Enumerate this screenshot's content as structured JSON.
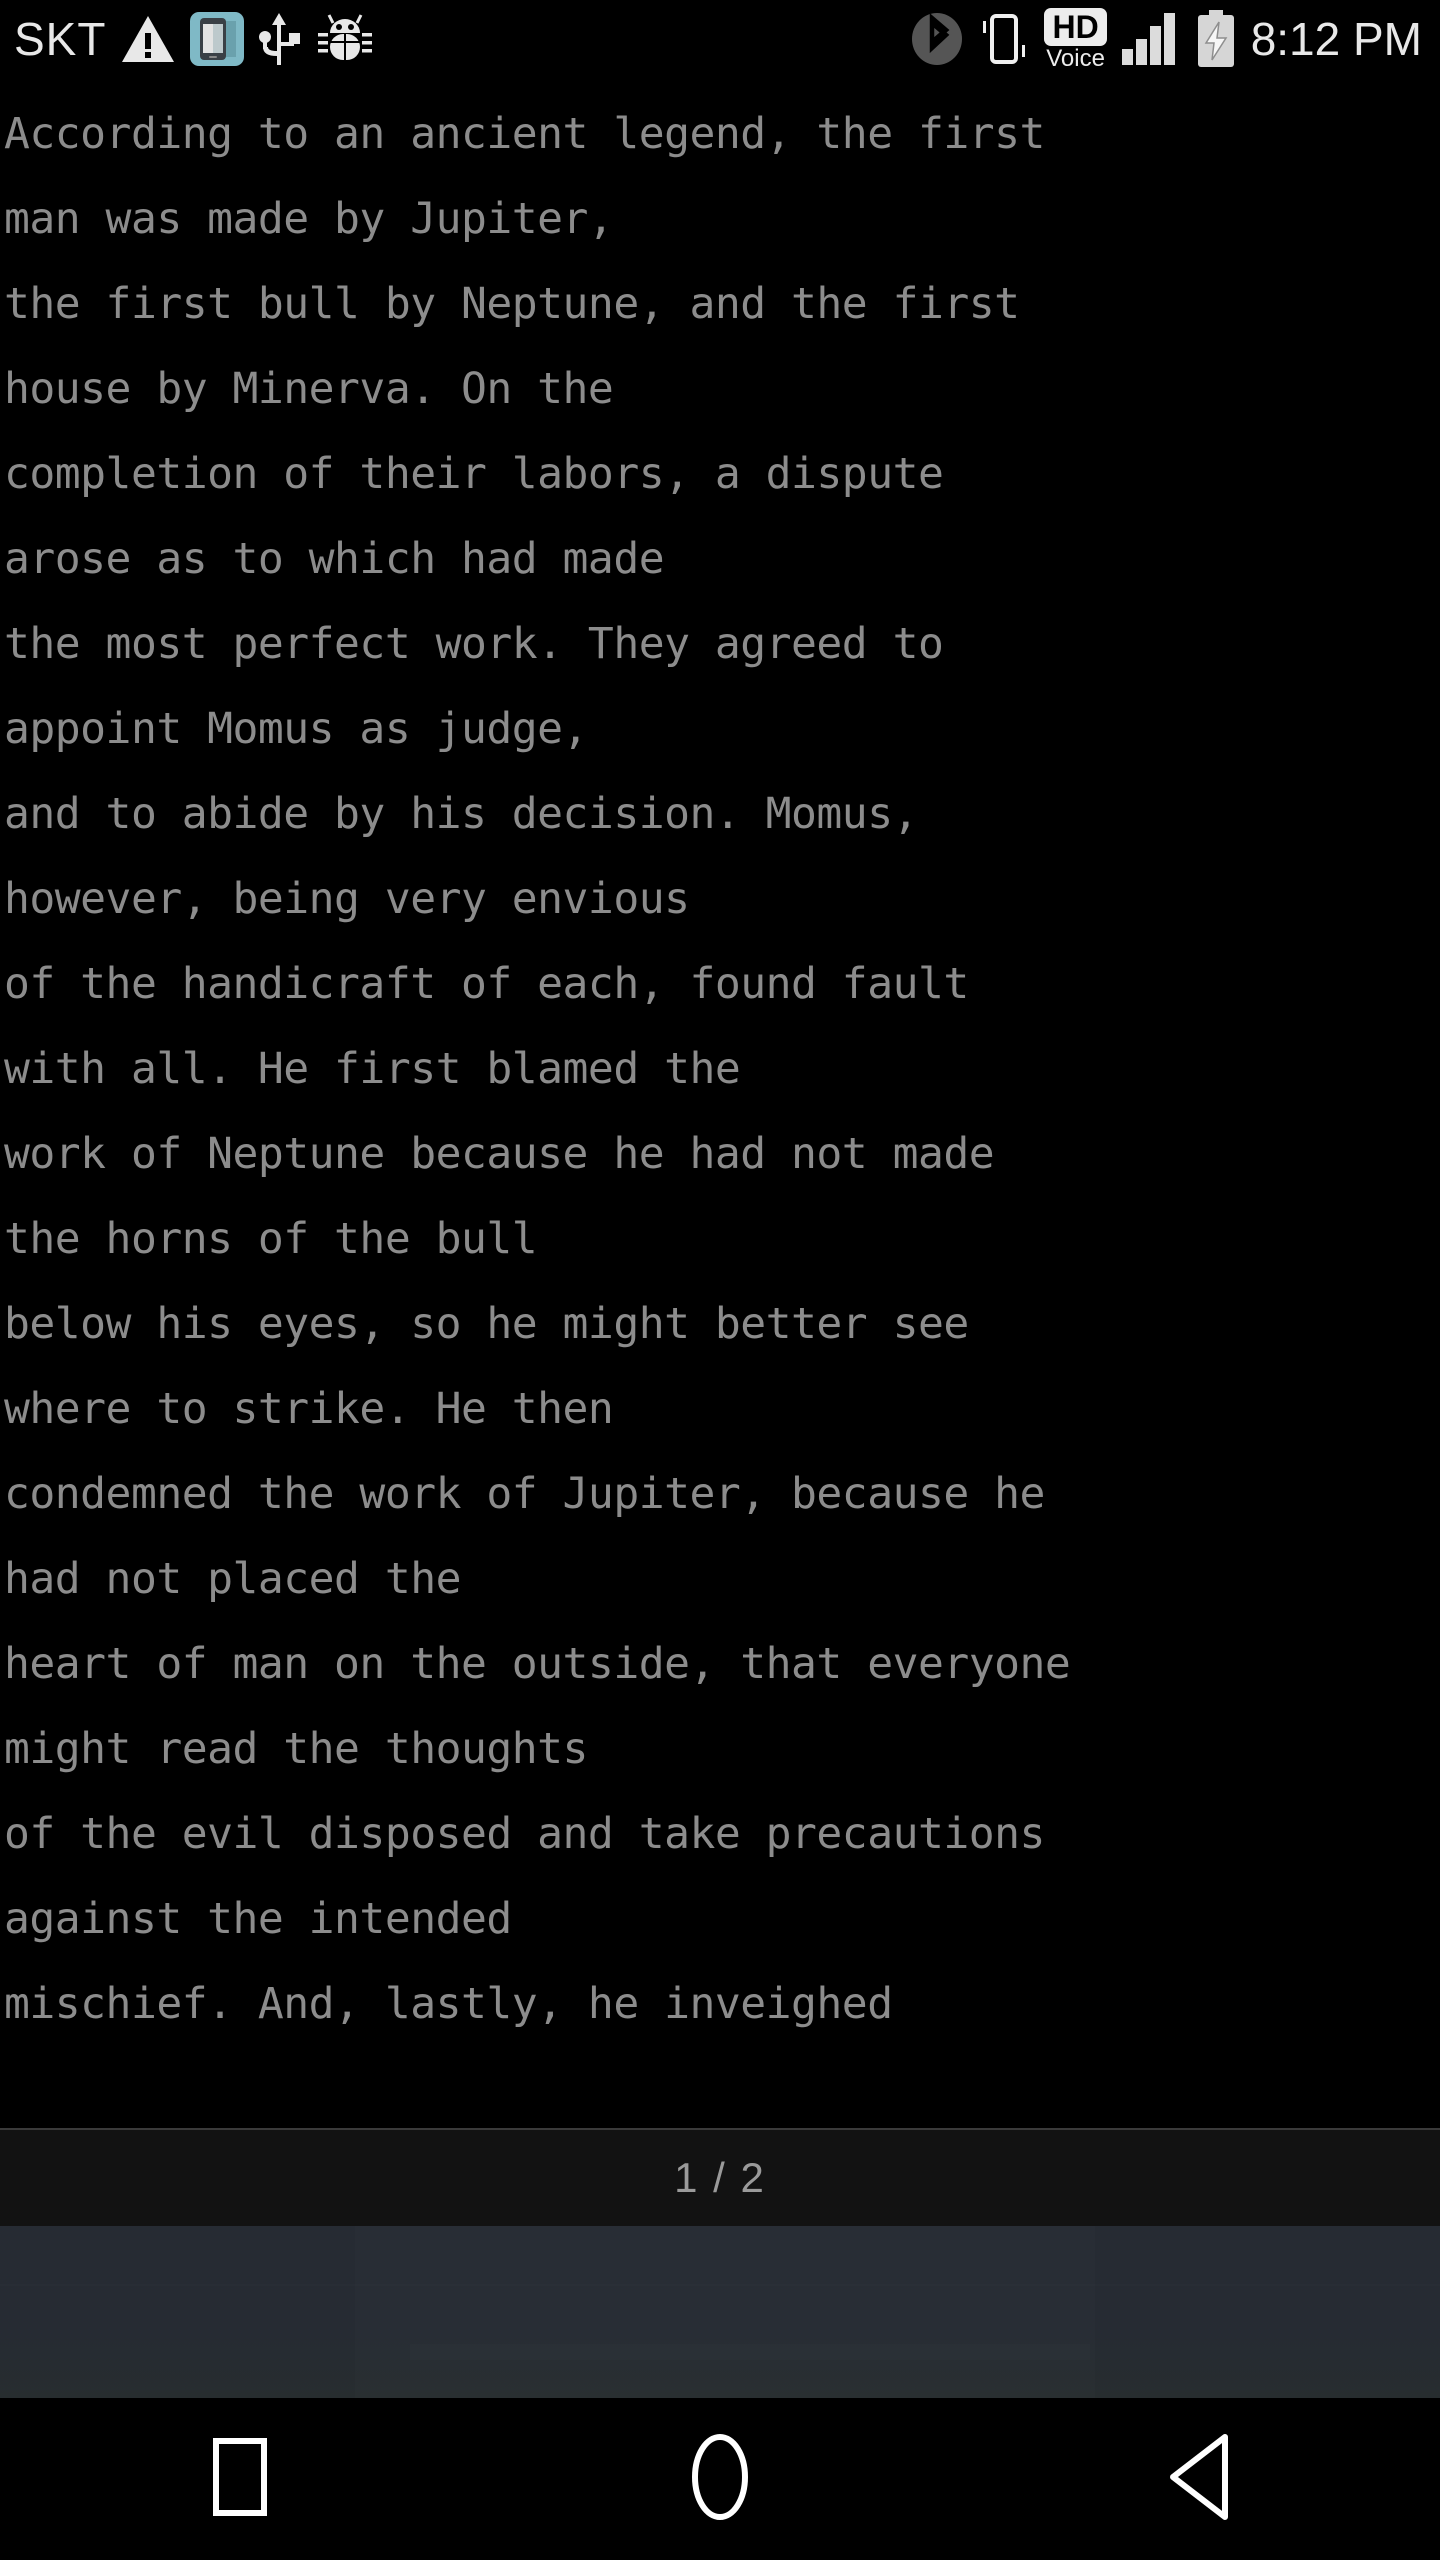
{
  "status_bar": {
    "carrier": "SKT",
    "clock": "8:12 PM",
    "hd_voice_label": "HD",
    "hd_voice_sub": "Voice",
    "left_icons": [
      {
        "name": "warning-triangle-icon",
        "label": "warning"
      },
      {
        "name": "phone-app-icon",
        "label": "device app"
      },
      {
        "name": "usb-icon",
        "label": "usb connected"
      },
      {
        "name": "android-debug-bug-icon",
        "label": "usb debugging"
      }
    ],
    "right_icons": [
      {
        "name": "bluetooth-icon",
        "label": "bluetooth"
      },
      {
        "name": "vibrate-icon",
        "label": "vibrate mode"
      },
      {
        "name": "hd-voice-icon",
        "label": "HD Voice"
      },
      {
        "name": "signal-bars-icon",
        "label": "signal strength"
      },
      {
        "name": "battery-charging-icon",
        "label": "battery charging"
      }
    ],
    "colors": {
      "background": "#000000",
      "icon_light": "#e8e8e8",
      "icon_dim": "#5a5a5a",
      "phone_app_accent": "#7fb9c6"
    }
  },
  "reader": {
    "text_color": "#8c8c8c",
    "background": "#000000",
    "lines": [
      "According to an ancient legend, the first",
      "man was made by Jupiter,",
      "the first bull by Neptune, and the first",
      "house by Minerva. On the",
      "completion of their labors, a dispute",
      "arose as to which had made",
      "the most perfect work. They agreed to",
      "appoint Momus as judge,",
      "and to abide by his decision. Momus,",
      "however, being very envious",
      "of the handicraft of each, found fault",
      "with all. He first blamed the",
      "work of Neptune because he had not made",
      "the horns of the bull",
      "below his eyes, so he might better see",
      "where to strike. He then",
      "condemned the work of Jupiter, because he",
      "had not placed the",
      "heart of man on the outside, that everyone",
      "might read the thoughts",
      "of the evil disposed and take precautions",
      "against the intended",
      "mischief. And, lastly, he inveighed"
    ]
  },
  "page_indicator": {
    "text": "1 / 2",
    "current_page": "1",
    "total_pages": "2",
    "background": "#121212"
  },
  "lower_panel": {
    "background": "#262b33"
  },
  "nav_bar": {
    "background": "#000000",
    "buttons": [
      {
        "name": "recents-button",
        "icon": "square-icon",
        "label": "Recents"
      },
      {
        "name": "home-button",
        "icon": "circle-icon",
        "label": "Home"
      },
      {
        "name": "back-button",
        "icon": "triangle-left-icon",
        "label": "Back"
      }
    ]
  }
}
